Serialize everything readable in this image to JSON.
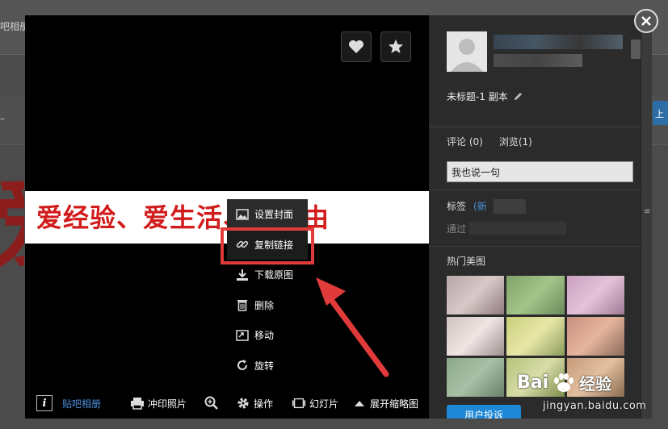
{
  "background_page": {
    "top_left_text": "吧相册",
    "mid_left_text": "–",
    "red_big_text": "爱",
    "right_edge_button": "上"
  },
  "viewer": {
    "photo_text": "爱经验、爱生活、爱自由",
    "context_menu": [
      {
        "label": "设置封面",
        "icon": "image-icon"
      },
      {
        "label": "复制链接",
        "icon": "link-icon"
      },
      {
        "label": "下载原图",
        "icon": "download-icon"
      },
      {
        "label": "删除",
        "icon": "trash-icon"
      },
      {
        "label": "移动",
        "icon": "move-icon"
      },
      {
        "label": "旋转",
        "icon": "rotate-icon"
      }
    ],
    "toolbar": {
      "tieba_album": "贴吧相册",
      "print": "冲印照片",
      "operate": "操作",
      "slideshow": "幻灯片",
      "expand_thumbs": "展开缩略图"
    }
  },
  "panel": {
    "photo_name": "未标题-1 副本",
    "tab_comments": "评论 (0)",
    "tab_views": "浏览(1)",
    "comment_placeholder": "我也说一句",
    "tags_label": "标签",
    "tags_new": "(新",
    "tags_via": "通过",
    "hot_label": "热门美图",
    "report_button": "用户投诉"
  },
  "watermark": {
    "brand": "Bai",
    "brand_suffix": "经验",
    "url": "jingyan.baidu.com"
  },
  "colors": {
    "accent_blue": "#4a90d9",
    "highlight_red": "#e03a3a",
    "report_blue": "#1e88d6"
  }
}
